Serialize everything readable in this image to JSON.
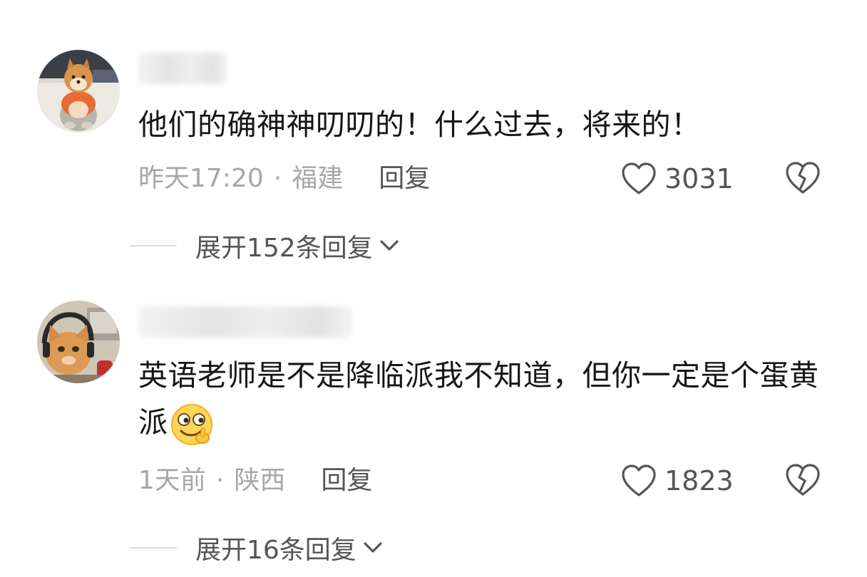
{
  "comments": [
    {
      "text": "他们的确神神叨叨的！什么过去，将来的！",
      "time": "昨天17:20",
      "location": "福建",
      "reply_label": "回复",
      "likes": "3031",
      "expand_label": "展开152条回复"
    },
    {
      "text": "英语老师是不是降临派我不知道，但你一定是个蛋黄派",
      "time": "1天前",
      "location": "陕西",
      "reply_label": "回复",
      "likes": "1823",
      "expand_label": "展开16条回复"
    }
  ],
  "separator": "·",
  "icons": {
    "like": "heart-outline-icon",
    "dislike": "broken-heart-icon",
    "expand": "chevron-down-icon",
    "emoji": "smirk-emoji-icon"
  },
  "colors": {
    "text": "#161616",
    "meta": "#a7a7a7",
    "action": "#555555"
  }
}
